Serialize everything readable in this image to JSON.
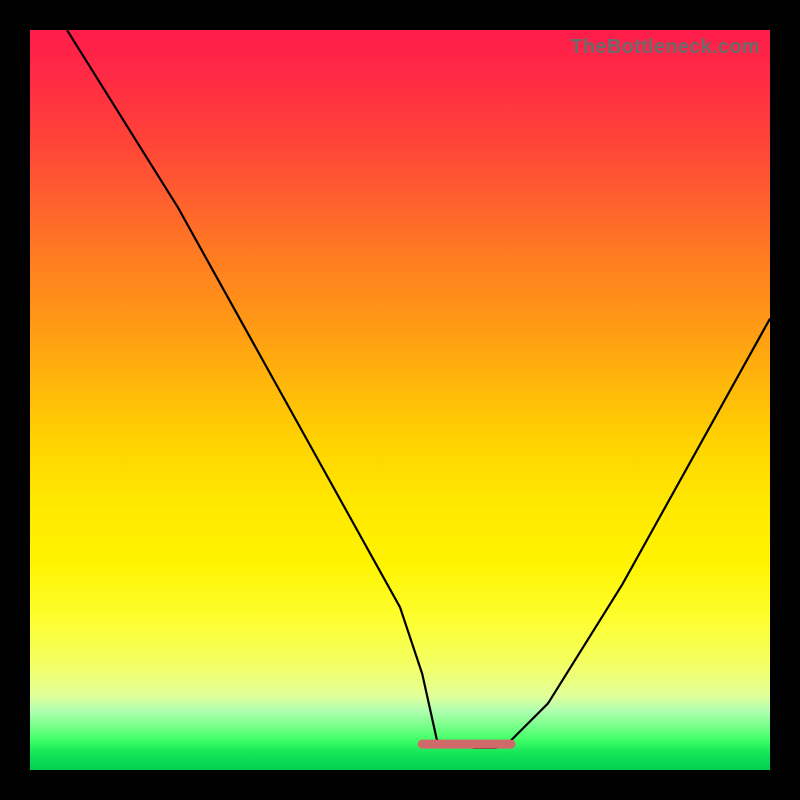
{
  "watermark": "TheBottleneck.com",
  "colors": {
    "frame": "#000000",
    "curve": "#000000",
    "flat_segment": "#d06a6a",
    "gradient_top": "#ff1c4a",
    "gradient_bottom": "#00d050"
  },
  "chart_data": {
    "type": "line",
    "title": "",
    "xlabel": "",
    "ylabel": "",
    "xlim": [
      0,
      100
    ],
    "ylim": [
      0,
      100
    ],
    "series": [
      {
        "name": "bottleneck-curve",
        "x": [
          5,
          10,
          15,
          20,
          25,
          30,
          35,
          40,
          45,
          50,
          53,
          55,
          60,
          63,
          65,
          70,
          75,
          80,
          85,
          90,
          95,
          100
        ],
        "y": [
          100,
          92,
          84,
          76,
          67,
          58,
          49,
          40,
          31,
          22,
          13,
          4,
          3,
          3,
          4,
          9,
          17,
          25,
          34,
          43,
          52,
          61
        ]
      }
    ],
    "flat_region": {
      "x_start": 53,
      "x_end": 65,
      "y": 3.5
    }
  }
}
